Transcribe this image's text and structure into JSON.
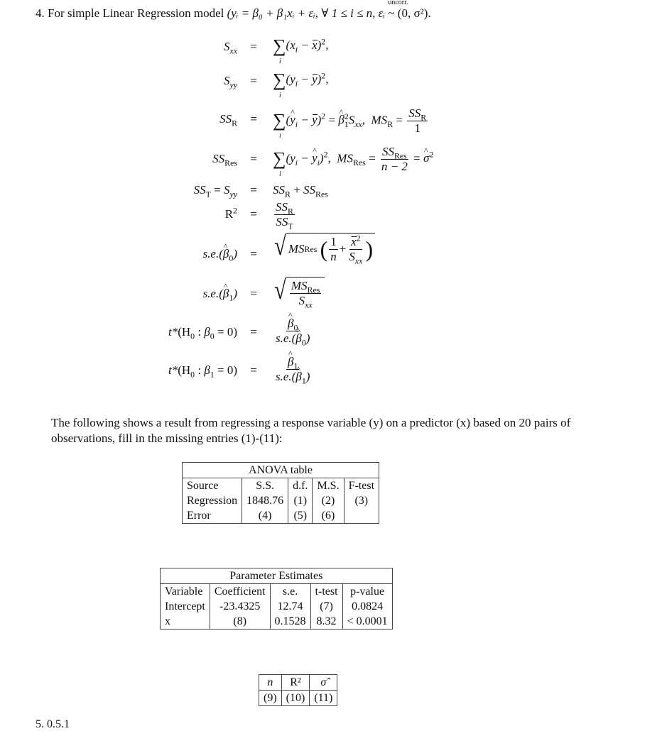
{
  "problem": {
    "number": "4.",
    "intro_text": "For simple Linear Regression model",
    "model_eq": "(yᵢ = β₀ + β₁xᵢ + εᵢ, ∀ 1 ≤ i ≤ n, εᵢ",
    "dist_label": "uncorr.",
    "dist_symbol": "~",
    "dist_params": "(0, σ²)."
  },
  "equations": [
    {
      "id": "sxx",
      "lhs": "S_xx",
      "rhs": "Σᵢ (xᵢ − x̄)²,"
    },
    {
      "id": "syy",
      "lhs": "S_yy",
      "rhs": "Σᵢ (yᵢ − ȳ)²,"
    },
    {
      "id": "ssr",
      "lhs": "SS_R",
      "rhs": "Σᵢ (ŷᵢ − ȳ)² = β̂₁² S_xx,  MS_R = SS_R / 1"
    },
    {
      "id": "ssres",
      "lhs": "SS_Res",
      "rhs": "Σᵢ (yᵢ − ŷᵢ)²,  MS_Res = SS_Res / (n − 2) = σ̂²"
    },
    {
      "id": "sst",
      "lhs": "SS_T = S_yy",
      "rhs": "SS_R + SS_Res"
    },
    {
      "id": "r2",
      "lhs": "R²",
      "rhs": "SS_R / SS_T"
    },
    {
      "id": "se-b0",
      "lhs": "s.e.(β̂₀)",
      "rhs": "√( MS_Res (1/n + x̄²/S_xx) )"
    },
    {
      "id": "se-b1",
      "lhs": "s.e.(β̂₁)",
      "rhs": "√( MS_Res / S_xx )"
    },
    {
      "id": "t-b0",
      "lhs": "t*(H₀ : β₀ = 0)",
      "rhs": "β̂₀ / s.e.(β̂₀)"
    },
    {
      "id": "t-b1",
      "lhs": "t*(H₀ : β₁ = 0)",
      "rhs": "β̂₁ / s.e.(β̂₁)"
    }
  ],
  "text": {
    "eq_sign": "=",
    "plus": "+",
    "one": "1",
    "n_minus_2": "n − 2",
    "se_prefix": "s.e.",
    "t_star": "t*",
    "h0": "H",
    "zero": "0",
    "sub_i": "i",
    "intro_paragraph": "The following shows a result from regressing a response variable (y) on a predictor (x) based on 20 pairs of observations, fill in the missing entries (1)-(11):"
  },
  "anova_table": {
    "caption": "ANOVA table",
    "headers": [
      "Source",
      "S.S.",
      "d.f.",
      "M.S.",
      "F-test"
    ],
    "rows": [
      [
        "Regression",
        "1848.76",
        "(1)",
        "(2)",
        "(3)"
      ],
      [
        "Error",
        "(4)",
        "(5)",
        "(6)",
        ""
      ]
    ]
  },
  "params_table": {
    "caption": "Parameter Estimates",
    "headers": [
      "Variable",
      "Coefficient",
      "s.e.",
      "t-test",
      "p-value"
    ],
    "rows": [
      [
        "Intercept",
        "-23.4325",
        "12.74",
        "(7)",
        "0.0824"
      ],
      [
        "x",
        "(8)",
        "0.1528",
        "8.32",
        "< 0.0001"
      ]
    ]
  },
  "summary_table": {
    "headers": [
      "n",
      "R²",
      "σ̂"
    ],
    "rows": [
      [
        "(9)",
        "(10)",
        "(11)"
      ]
    ]
  },
  "next_problem_fragment": "5. 0.5.1"
}
